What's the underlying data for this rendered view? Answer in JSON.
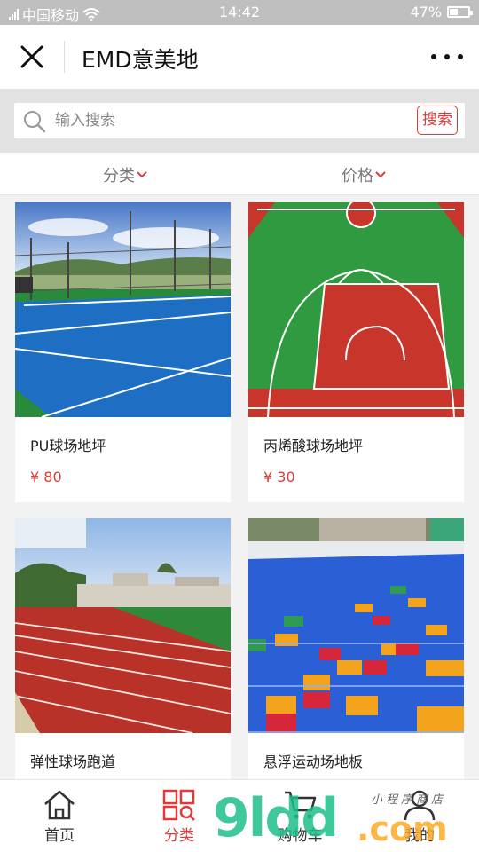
{
  "status_bar": {
    "carrier": "中国移动",
    "time": "14:42",
    "battery": "47%",
    "battery_level": 0.47
  },
  "header": {
    "title": "EMD意美地",
    "close_icon": "close-icon",
    "more_icon": "more-icon"
  },
  "search": {
    "placeholder": "输入搜索",
    "button_label": "搜索"
  },
  "filters": {
    "category_label": "分类",
    "price_label": "价格"
  },
  "products": [
    {
      "name": "PU球场地坪",
      "price": "¥ 80",
      "image": "blue tennis court"
    },
    {
      "name": "丙烯酸球场地坪",
      "price": "¥ 30",
      "image": "green and red basketball court"
    },
    {
      "name": "弹性球场跑道",
      "price": "",
      "image": "red running track"
    },
    {
      "name": "悬浮运动场地板",
      "price": "",
      "image": "multicolor suspended tile floor"
    }
  ],
  "tabbar": {
    "home": "首页",
    "category": "分类",
    "cart": "购物车",
    "mine": "我的"
  },
  "watermark": {
    "brand": "9ldd",
    "domain": ".com",
    "tagline": "小程序商店"
  },
  "colors": {
    "accent": "#e03a3a",
    "status_bar": "#bfbfbf",
    "search_bg": "#e3e3e3"
  }
}
